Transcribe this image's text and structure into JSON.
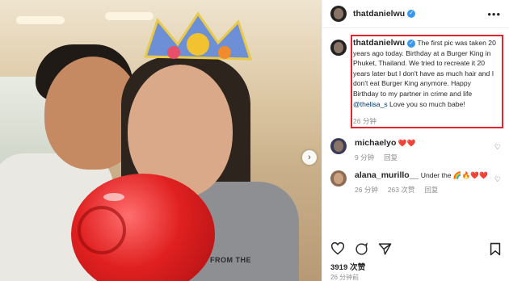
{
  "post": {
    "username": "thatdanielwu",
    "verified_mark": "✓",
    "more_label": "•••",
    "caption_pre": "The first pic was taken 20 years ago today. Birthday at a Burger King in Phuket, Thailand. We tried to recreate it 20 years later but I don't have as much hair and I don't eat Burger King anymore. Happy Birthday to my partner in crime and life ",
    "caption_mention": "@thelisa_s",
    "caption_post": " Love you so much babe!",
    "caption_time": "26 分钟",
    "photo_print": "FROM THE"
  },
  "comments": [
    {
      "username": "michaelyo",
      "text": "❤️❤️",
      "time": "9 分钟",
      "reply": "回复"
    },
    {
      "username": "alana_murillo__",
      "text": "Under the 🌈🔥❤️❤️",
      "time": "26 分钟",
      "likes": "263 次赞",
      "reply": "回复"
    }
  ],
  "footer": {
    "likes": "3919 次赞",
    "time": "26 分钟前"
  },
  "icons": {
    "heart": "heart-icon",
    "comment": "comment-icon",
    "share": "share-icon",
    "bookmark": "bookmark-icon",
    "next": "chevron-right-icon"
  },
  "colors": {
    "highlight_border": "#e0262e",
    "verified": "#3897f0",
    "mention": "#00376b"
  }
}
